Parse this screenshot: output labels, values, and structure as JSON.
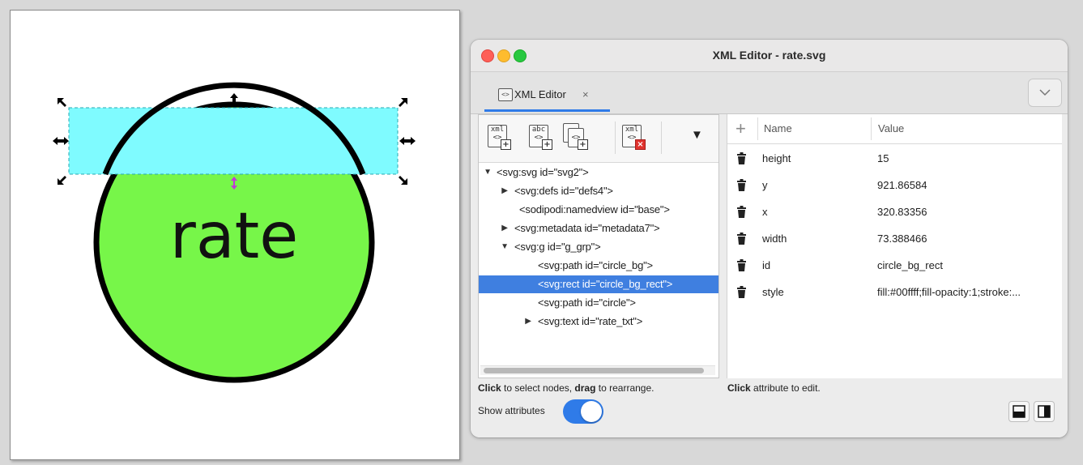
{
  "canvas": {
    "rect_fill": "#7ffbff",
    "circle_fill": "#77f649",
    "circle_text": "rate"
  },
  "window": {
    "title": "XML Editor - rate.svg",
    "tab_label": "XML Editor",
    "tab_close": "×",
    "tab_menu_icon": "chevron-down-icon",
    "toolbar": {
      "buttons": [
        {
          "icon": "new-element-node-icon",
          "text": "xml"
        },
        {
          "icon": "new-text-node-icon",
          "text": "abc"
        },
        {
          "icon": "duplicate-node-icon",
          "text": ""
        },
        {
          "icon": "delete-node-icon",
          "text": "xml"
        }
      ],
      "more_icon": "▼"
    },
    "tree": [
      {
        "text": "<svg:svg id=\"svg2\">",
        "twisty": "▼",
        "indent": 0
      },
      {
        "text": "<svg:defs id=\"defs4\">",
        "twisty": "▶",
        "indent": 1
      },
      {
        "text": "<sodipodi:namedview id=\"base\">",
        "twisty": "",
        "indent": 1
      },
      {
        "text": "<svg:metadata id=\"metadata7\">",
        "twisty": "▶",
        "indent": 1
      },
      {
        "text": "<svg:g id=\"g_grp\">",
        "twisty": "▼",
        "indent": 1
      },
      {
        "text": "<svg:path id=\"circle_bg\">",
        "twisty": "",
        "indent": 2
      },
      {
        "text": "<svg:rect id=\"circle_bg_rect\">",
        "twisty": "",
        "indent": 2,
        "selected": true
      },
      {
        "text": "<svg:path id=\"circle\">",
        "twisty": "",
        "indent": 2
      },
      {
        "text": "<svg:text id=\"rate_txt\">",
        "twisty": "▶",
        "indent": 2
      }
    ],
    "hint_left_bold1": "Click",
    "hint_left_mid": " to select nodes, ",
    "hint_left_bold2": "drag",
    "hint_left_end": " to rearrange.",
    "hint_right_bold": "Click",
    "hint_right_end": " attribute to edit.",
    "show_attributes_label": "Show attributes",
    "show_attributes_on": true,
    "attr_header": {
      "add_icon": "+",
      "name": "Name",
      "value": "Value"
    },
    "attributes": [
      {
        "name": "height",
        "value": "15"
      },
      {
        "name": "y",
        "value": "921.86584"
      },
      {
        "name": "x",
        "value": "320.83356"
      },
      {
        "name": "width",
        "value": "73.388466"
      },
      {
        "name": "id",
        "value": "circle_bg_rect"
      },
      {
        "name": "style",
        "value": "fill:#00ffff;fill-opacity:1;stroke:..."
      }
    ],
    "colors": {
      "accent": "#2f7be8",
      "selection": "#3f7fe0"
    }
  }
}
